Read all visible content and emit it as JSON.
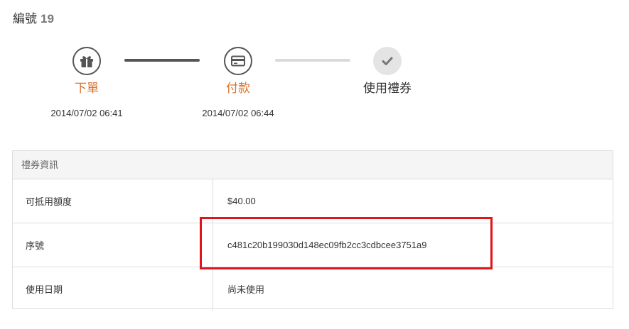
{
  "order": {
    "label": "編號",
    "number": "19"
  },
  "progress": {
    "steps": [
      {
        "icon": "gift-icon",
        "label": "下單",
        "time": "2014/07/02 06:41",
        "status": "done"
      },
      {
        "icon": "credit-card-icon",
        "label": "付款",
        "time": "2014/07/02 06:44",
        "status": "done"
      },
      {
        "icon": "check-icon",
        "label": "使用禮券",
        "time": "",
        "status": "pending"
      }
    ]
  },
  "voucher_info": {
    "title": "禮券資訊",
    "rows": [
      {
        "label": "可抵用額度",
        "value": "$40.00"
      },
      {
        "label": "序號",
        "value": "c481c20b199030d148ec09fb2cc3cdbcee3751a9"
      },
      {
        "label": "使用日期",
        "value": "尚未使用"
      }
    ]
  },
  "colors": {
    "accent": "#d8722f",
    "highlight": "#e0141b",
    "border": "#dddddd"
  }
}
